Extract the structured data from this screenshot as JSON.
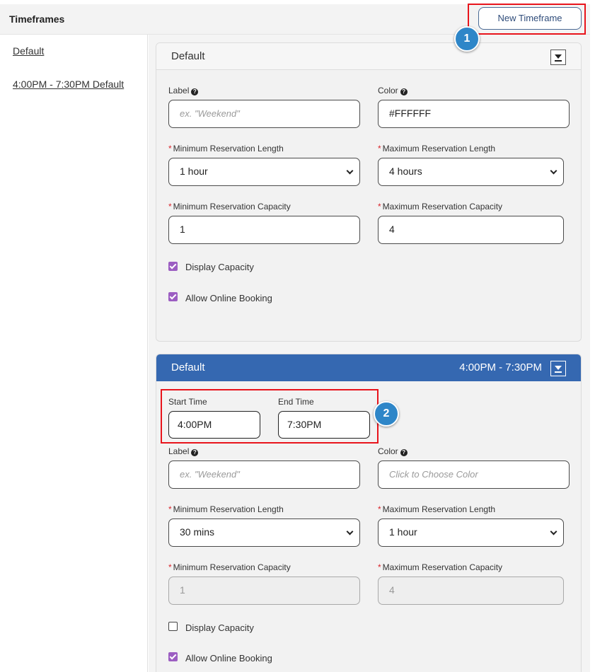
{
  "header": {
    "title": "Timeframes",
    "new_button": "New Timeframe"
  },
  "sidebar": {
    "links": [
      "Default",
      "4:00PM - 7:30PM Default"
    ]
  },
  "callouts": [
    "1",
    "2"
  ],
  "card1": {
    "title": "Default",
    "label_label": "Label",
    "label_placeholder": "ex. \"Weekend\"",
    "color_label": "Color",
    "color_value": "#FFFFFF",
    "min_len_label": "Minimum Reservation Length",
    "min_len_value": "1 hour",
    "max_len_label": "Maximum Reservation Length",
    "max_len_value": "4 hours",
    "min_cap_label": "Minimum Reservation Capacity",
    "min_cap_value": "1",
    "max_cap_label": "Maximum Reservation Capacity",
    "max_cap_value": "4",
    "display_capacity": {
      "label": "Display Capacity",
      "checked": true
    },
    "allow_online": {
      "label": "Allow Online Booking",
      "checked": true
    }
  },
  "card2": {
    "title": "Default",
    "time_range": "4:00PM - 7:30PM",
    "start_label": "Start Time",
    "start_value": "4:00PM",
    "end_label": "End Time",
    "end_value": "7:30PM",
    "label_label": "Label",
    "label_placeholder": "ex. \"Weekend\"",
    "color_label": "Color",
    "color_placeholder": "Click to Choose Color",
    "min_len_label": "Minimum Reservation Length",
    "min_len_value": "30 mins",
    "max_len_label": "Maximum Reservation Length",
    "max_len_value": "1 hour",
    "min_cap_label": "Minimum Reservation Capacity",
    "min_cap_value": "1",
    "max_cap_label": "Maximum Reservation Capacity",
    "max_cap_value": "4",
    "display_capacity": {
      "label": "Display Capacity",
      "checked": false
    },
    "allow_online": {
      "label": "Allow Online Booking",
      "checked": true
    }
  },
  "colors": {
    "accent": "#3568b1",
    "highlight": "#e8141c",
    "callout": "#2e86c8",
    "checkbox": "#9c5ec2",
    "required": "#d9262c"
  }
}
